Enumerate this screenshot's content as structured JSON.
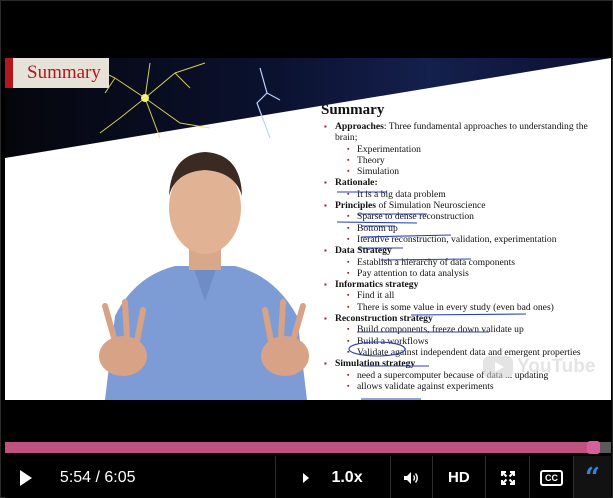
{
  "slide": {
    "tag": "Summary",
    "title": "Summary",
    "items": [
      {
        "kind": "top",
        "bold": "Approaches",
        "text": ": Three fundamental approaches to understanding the brain;"
      },
      {
        "kind": "sub",
        "text": "Experimentation"
      },
      {
        "kind": "sub",
        "text": "Theory"
      },
      {
        "kind": "sub",
        "text": "Simulation"
      },
      {
        "kind": "top",
        "bold": "Rationale:",
        "text": ""
      },
      {
        "kind": "sub",
        "text": "It is a big data problem"
      },
      {
        "kind": "top",
        "bold": "Principles",
        "text": " of Simulation Neuroscience"
      },
      {
        "kind": "sub",
        "text": "Sparse to dense reconstruction"
      },
      {
        "kind": "sub",
        "text": "Bottom up"
      },
      {
        "kind": "sub",
        "text": "Iterative reconstruction, validation, experimentation"
      },
      {
        "kind": "top",
        "bold": "Data Strategy",
        "text": ""
      },
      {
        "kind": "sub",
        "text": "Establish a hierarchy of data components"
      },
      {
        "kind": "sub",
        "text": "Pay attention to data analysis"
      },
      {
        "kind": "top",
        "bold": "Informatics strategy",
        "text": ""
      },
      {
        "kind": "sub",
        "text": "Find it all"
      },
      {
        "kind": "sub",
        "text": "There is some value in every study (even bad ones)"
      },
      {
        "kind": "top",
        "bold": "Reconstruction strategy",
        "text": ""
      },
      {
        "kind": "sub",
        "text": "Build components, freeze down validate up"
      },
      {
        "kind": "sub",
        "text": "Build a workflows"
      },
      {
        "kind": "sub",
        "text": "Validate against independent data and emergent properties"
      },
      {
        "kind": "top",
        "bold": "Simulation strategy",
        "text": ""
      },
      {
        "kind": "sub",
        "text": "need a supercomputer because of data ... updating"
      },
      {
        "kind": "sub",
        "text": "allows validate against experiments"
      }
    ]
  },
  "watermark": "YouTube",
  "player": {
    "time": "5:54 / 6:05",
    "progress": 0.97,
    "speed": "1.0x",
    "quality": "HD",
    "cc_label": "CC",
    "transcript_icon": "“"
  },
  "colors": {
    "progress_fill": "#c05280",
    "accent_blue": "#2f86e8",
    "slide_red": "#b3161b"
  },
  "icons": [
    "play-icon",
    "chevron-right-icon",
    "volume-icon",
    "fullscreen-icon",
    "closed-captions-icon",
    "transcript-icon"
  ]
}
